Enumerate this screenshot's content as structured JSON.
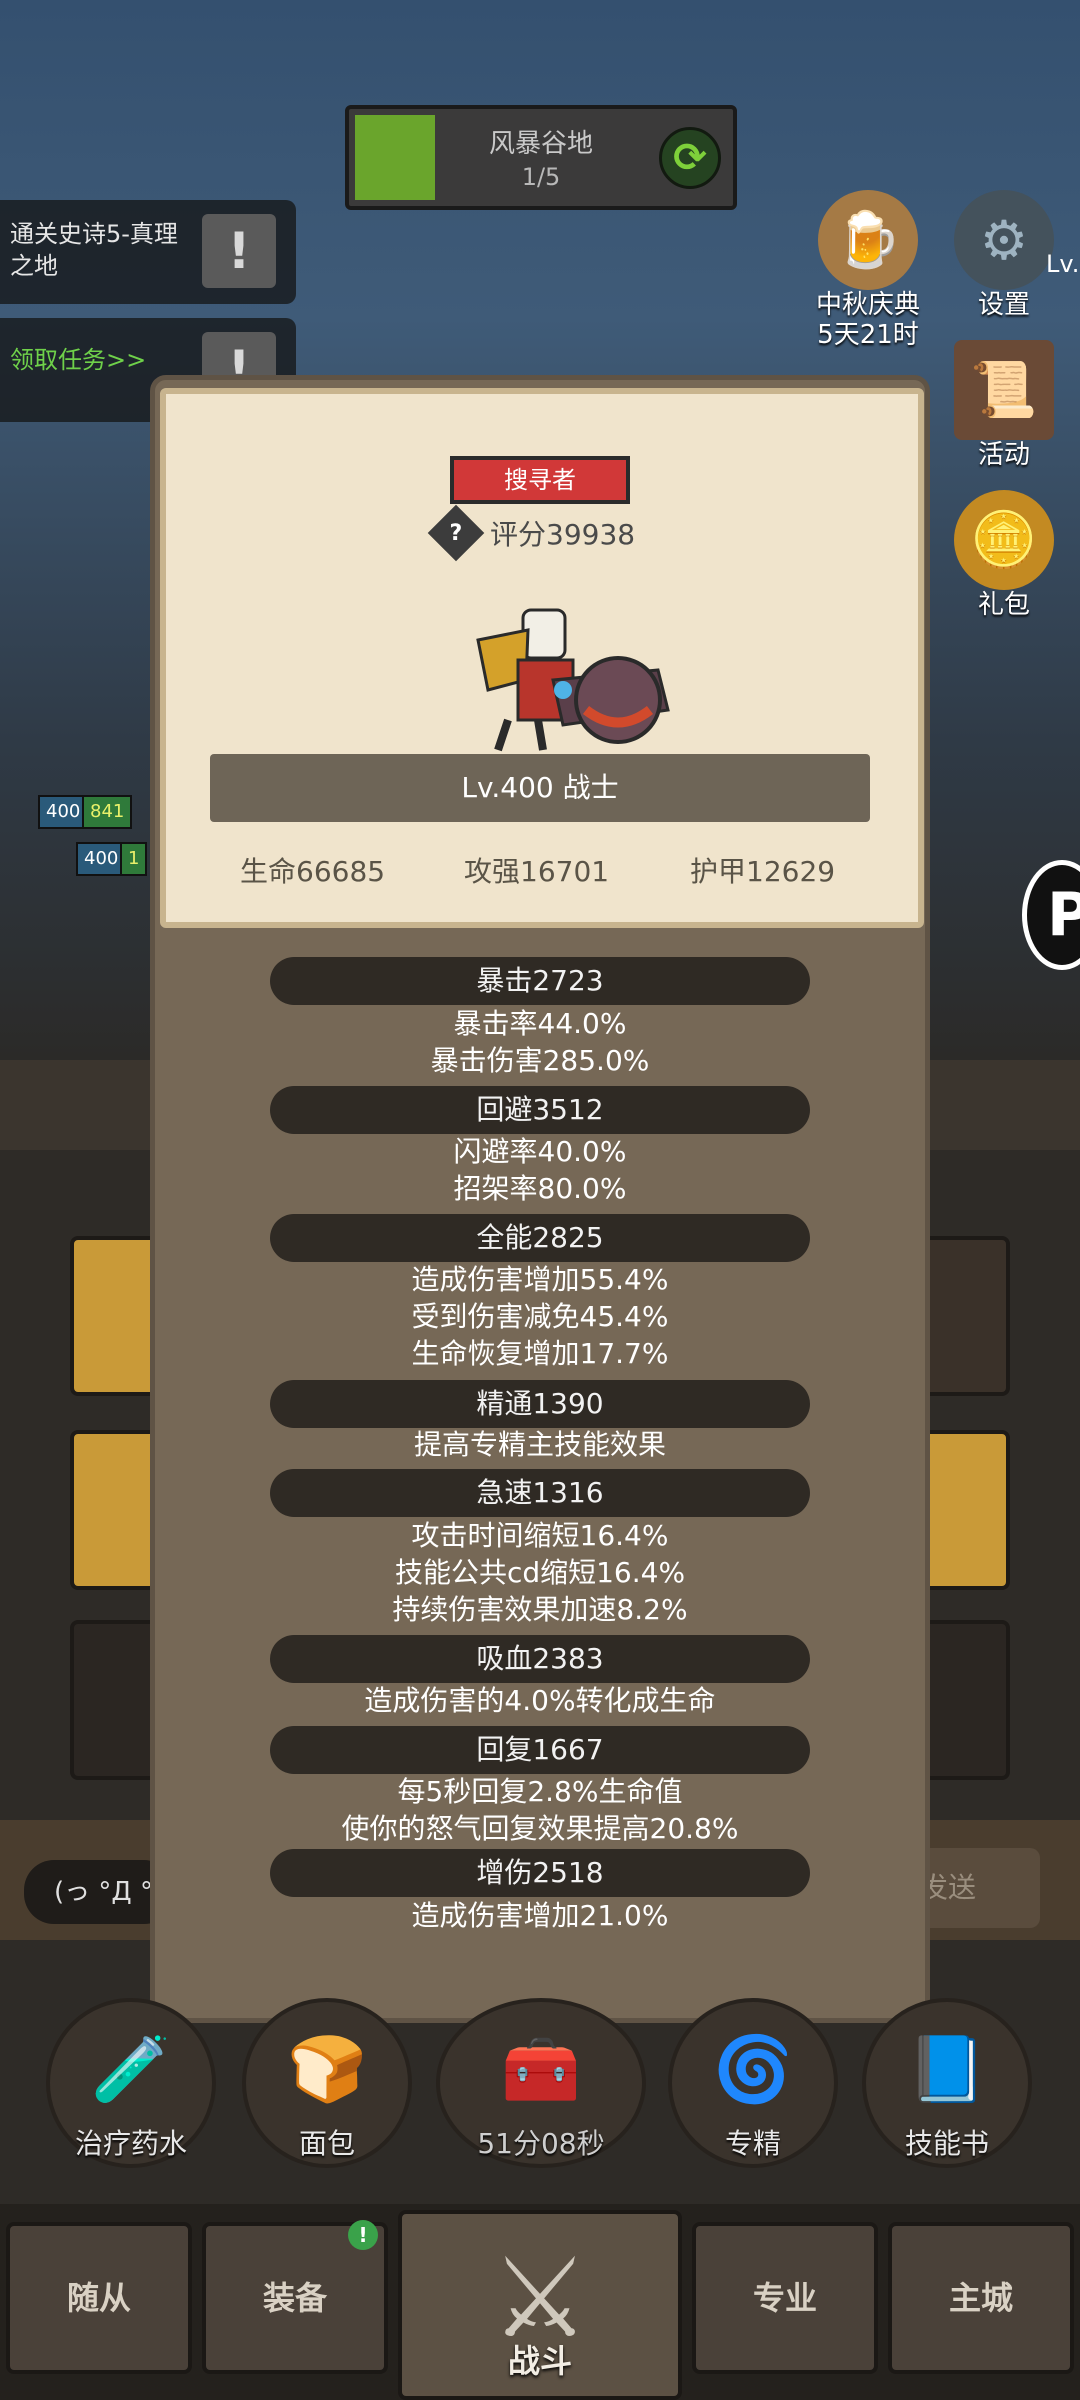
{
  "stage": {
    "name": "风暴谷地",
    "count": "1/5"
  },
  "quests": [
    {
      "text": "通关史诗5-真理之地"
    },
    {
      "text": "领取任务>>"
    }
  ],
  "side_menu": [
    {
      "label": "中秋庆典",
      "sub": "5天21时",
      "icon": "beer-mug-icon"
    },
    {
      "label": "设置",
      "icon": "gear-icon"
    },
    {
      "label": "活动",
      "icon": "scroll-icon"
    },
    {
      "label": "礼包",
      "icon": "gift-coin-icon"
    }
  ],
  "side_level_partial": "Lv.",
  "hero_card": {
    "rank": "搜寻者",
    "score": "评分39938",
    "level": "Lv.400 战士",
    "stats": {
      "hp": "生命66685",
      "atk": "攻强16701",
      "armor": "护甲12629"
    }
  },
  "attributes": [
    {
      "title": "暴击2723",
      "lines": [
        "暴击率44.0%",
        "暴击伤害285.0%"
      ]
    },
    {
      "title": "回避3512",
      "lines": [
        "闪避率40.0%",
        "招架率80.0%"
      ]
    },
    {
      "title": "全能2825",
      "lines": [
        "造成伤害增加55.4%",
        "受到伤害减免45.4%",
        "生命恢复增加17.7%"
      ]
    },
    {
      "title": "精通1390",
      "lines": [
        "提高专精主技能效果"
      ]
    },
    {
      "title": "急速1316",
      "lines": [
        "攻击时间缩短16.4%",
        "技能公共cd缩短16.4%",
        "持续伤害效果加速8.2%"
      ]
    },
    {
      "title": "吸血2383",
      "lines": [
        "造成伤害的4.0%转化成生命"
      ]
    },
    {
      "title": "回复1667",
      "lines": [
        "每5秒回复2.8%生命值",
        "使你的怒气回复效果提高20.8%"
      ]
    },
    {
      "title": "增伤2518",
      "lines": [
        "造成伤害增加21.0%"
      ]
    }
  ],
  "hp_tags": [
    "400",
    "841",
    "400",
    "1"
  ],
  "chat_placeholder": "(っ °Д °",
  "send_label": "发送",
  "actions": [
    {
      "label": "治疗药水",
      "icon": "potion-icon"
    },
    {
      "label": "面包",
      "icon": "bread-icon"
    },
    {
      "label": "51分08秒",
      "icon": "chest-icon"
    },
    {
      "label": "专精",
      "icon": "spec-icon"
    },
    {
      "label": "技能书",
      "icon": "book-icon"
    }
  ],
  "nav": {
    "followers": "随从",
    "equipment": "装备",
    "battle": "战斗",
    "profession": "专业",
    "main_city": "主城",
    "badge": "!"
  }
}
